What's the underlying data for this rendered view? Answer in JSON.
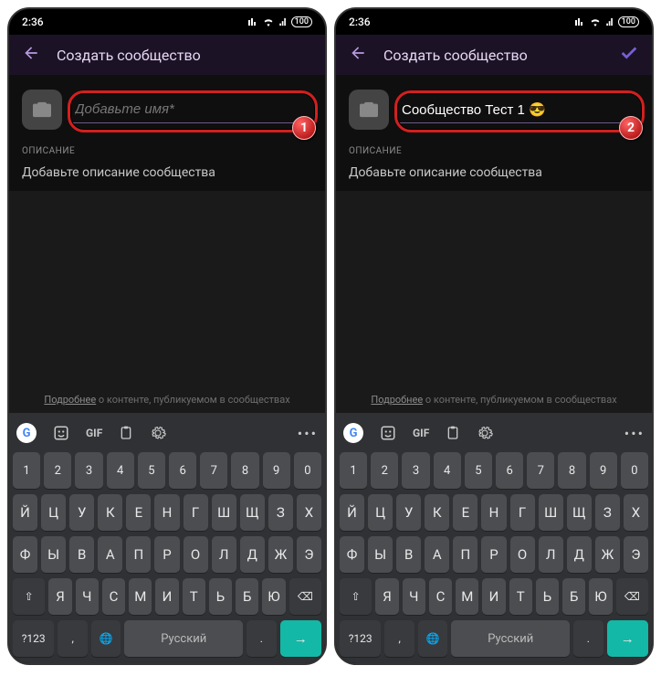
{
  "statusbar": {
    "time": "2:36",
    "battery": "100"
  },
  "screens": [
    {
      "title": "Создать сообщество",
      "show_check": false,
      "name_value": "",
      "name_placeholder": "Добавьте имя*",
      "badge": "1",
      "desc_label": "ОПИСАНИЕ",
      "desc_placeholder": "Добавьте описание сообщества",
      "info_underline": "Подробнее",
      "info_rest": " о контенте, публикуемом в сообществах"
    },
    {
      "title": "Создать сообщество",
      "show_check": true,
      "name_value": "Сообщество Тест 1 😎",
      "name_placeholder": "Добавьте имя*",
      "badge": "2",
      "desc_label": "ОПИСАНИЕ",
      "desc_placeholder": "Добавьте описание сообщества",
      "info_underline": "Подробнее",
      "info_rest": " о контенте, публикуемом в сообществах"
    }
  ],
  "keyboard": {
    "gif": "GIF",
    "row_nums": [
      "1",
      "2",
      "3",
      "4",
      "5",
      "6",
      "7",
      "8",
      "9",
      "0"
    ],
    "row1": [
      "Й",
      "Ц",
      "У",
      "К",
      "Е",
      "Н",
      "Г",
      "Ш",
      "Щ",
      "З",
      "Х"
    ],
    "row2": [
      "Ф",
      "Ы",
      "В",
      "А",
      "П",
      "Р",
      "О",
      "Л",
      "Д",
      "Ж",
      "Э"
    ],
    "row3": [
      "Я",
      "Ч",
      "С",
      "М",
      "И",
      "Т",
      "Ь",
      "Б",
      "Ю"
    ],
    "shift": "⇧",
    "backspace": "⌫",
    "sym": "?123",
    "comma": ",",
    "globe": "🌐",
    "lang": "Русский",
    "period": ".",
    "enter": "→"
  }
}
